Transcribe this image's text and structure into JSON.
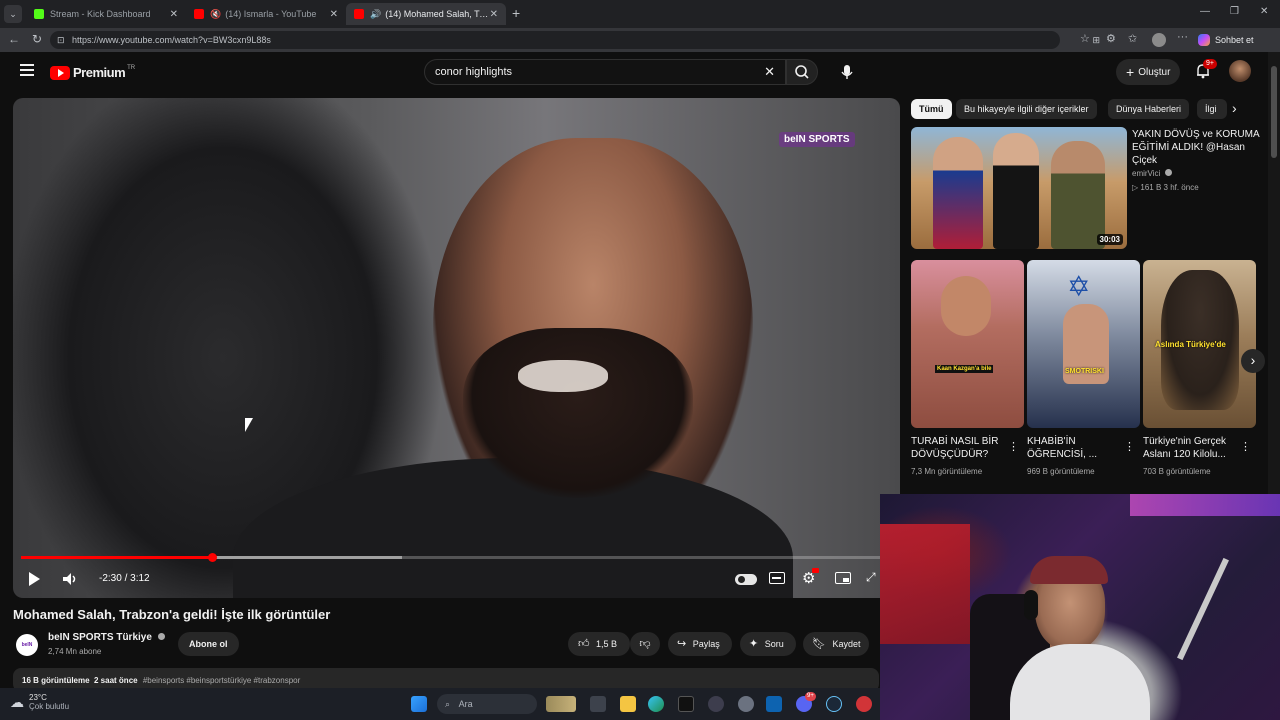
{
  "browser": {
    "tabs": [
      {
        "title": "Stream - Kick Dashboard",
        "active": false
      },
      {
        "title": "(14) Ismarla - YouTube",
        "active": false
      },
      {
        "title": "(14) Mohamed Salah, Trabzon",
        "active": true
      }
    ],
    "url": "https://www.youtube.com/watch?v=BW3cxn9L88s",
    "copilot_label": "Sohbet et"
  },
  "youtube": {
    "logo_text": "Premium",
    "logo_badge": "TR",
    "search": {
      "value": "conor highlights"
    },
    "create_label": "Oluştur",
    "notification_count": "9+",
    "player": {
      "watermark": "beIN SPORTS",
      "time": "-2:30 / 3:12",
      "progress": 0.22,
      "buffered": 0.44
    },
    "video": {
      "title": "Mohamed Salah, Trabzon'a geldi! İşte ilk görüntüler",
      "channel": "beIN SPORTS Türkiye",
      "subscribers": "2,74 Mn abone",
      "subscribe_label": "Abone ol",
      "likes": "1,5 B",
      "share_label": "Paylaş",
      "ask_label": "Soru",
      "save_label": "Kaydet",
      "description_meta": "16 B görüntüleme  2 saat önce",
      "hashtags": "#beinsports #beinsportstürkiye #trabzonspor"
    },
    "chips": [
      "Tümü",
      "Bu hikayeyle ilgili diğer içerikler",
      "Dünya Haberleri",
      "İlgi"
    ],
    "recommended": {
      "title_line1": "YAKIN DÖVÜŞ ve KORUMA",
      "title_line2": "EĞİTİMİ ALDIK! @Hasan",
      "title_line3": "Çiçek",
      "channel": "emirVici",
      "meta": "161 B  3 hf. önce",
      "duration": "30:03"
    },
    "shorts": [
      {
        "title1": "TURABİ NASIL BİR",
        "title2": "DÖVÜŞÇÜDÜR?",
        "views": "7,3 Mn görüntüleme",
        "caption": "Kaan Kazgan'a bile",
        "color": "#b36d60"
      },
      {
        "title1": "KHABİB'İN",
        "title2": "ÖĞRENCİSİ, ...",
        "views": "969 B görüntüleme",
        "caption": "SMOTRISKI",
        "color": "#7f8a9e"
      },
      {
        "title1": "Türkiye'nin Gerçek",
        "title2": "Aslanı 120 Kilolu...",
        "views": "703 B görüntüleme",
        "caption": "Aslında Türkiye'de",
        "color": "#9c7e5a"
      }
    ]
  },
  "taskbar": {
    "weather_temp": "23°C",
    "weather_desc": "Çok bulutlu",
    "search_placeholder": "Ara",
    "discord_badge": "9+"
  }
}
